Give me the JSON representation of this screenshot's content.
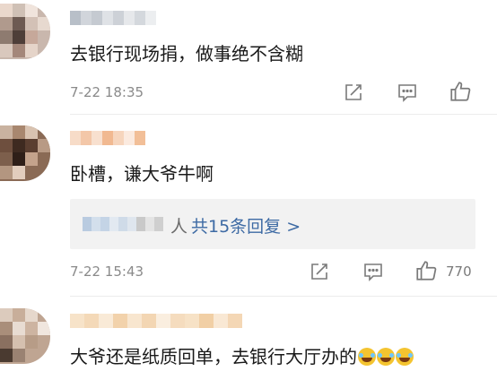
{
  "comments": [
    {
      "text": "去银行现场捐，做事绝不含糊",
      "time": "7-22 18:35",
      "likes": ""
    },
    {
      "text": "卧槽，谦大爷牛啊",
      "time": "7-22 15:43",
      "likes": "770",
      "reply_person": "人",
      "reply_link": "共15条回复 >"
    },
    {
      "text": "大爷还是纸质回单，去银行大厅办的",
      "emoji": [
        "laugh-cry-emoji",
        "laugh-cry-emoji",
        "laugh-cry-emoji"
      ]
    }
  ],
  "icons": {
    "share": "share-icon",
    "comment": "comment-icon",
    "like": "thumbs-up-icon"
  },
  "colors": {
    "link": "#3d6aa4",
    "time": "#8a8a8a",
    "reply_bg": "#f2f2f2"
  }
}
